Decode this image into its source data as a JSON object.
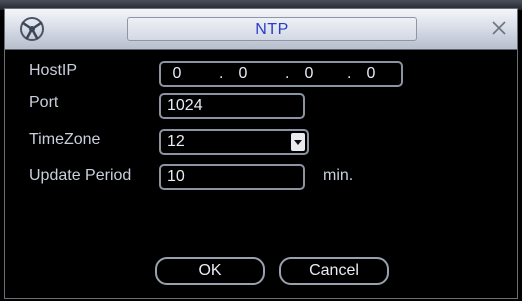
{
  "window": {
    "title": "NTP",
    "close_icon": "close-icon",
    "logo_icon": "app-logo-icon"
  },
  "form": {
    "hostip": {
      "label": "HostIP",
      "octets": [
        "0",
        "0",
        "0",
        "0"
      ]
    },
    "port": {
      "label": "Port",
      "value": "1024"
    },
    "timezone": {
      "label": "TimeZone",
      "value": "12"
    },
    "update_period": {
      "label": "Update Period",
      "value": "10",
      "unit": "min."
    }
  },
  "buttons": {
    "ok": "OK",
    "cancel": "Cancel"
  },
  "colors": {
    "title_text": "#2a3cc8",
    "label_text": "#c9cfdc",
    "field_border": "#8c93a1",
    "background": "#000000"
  }
}
